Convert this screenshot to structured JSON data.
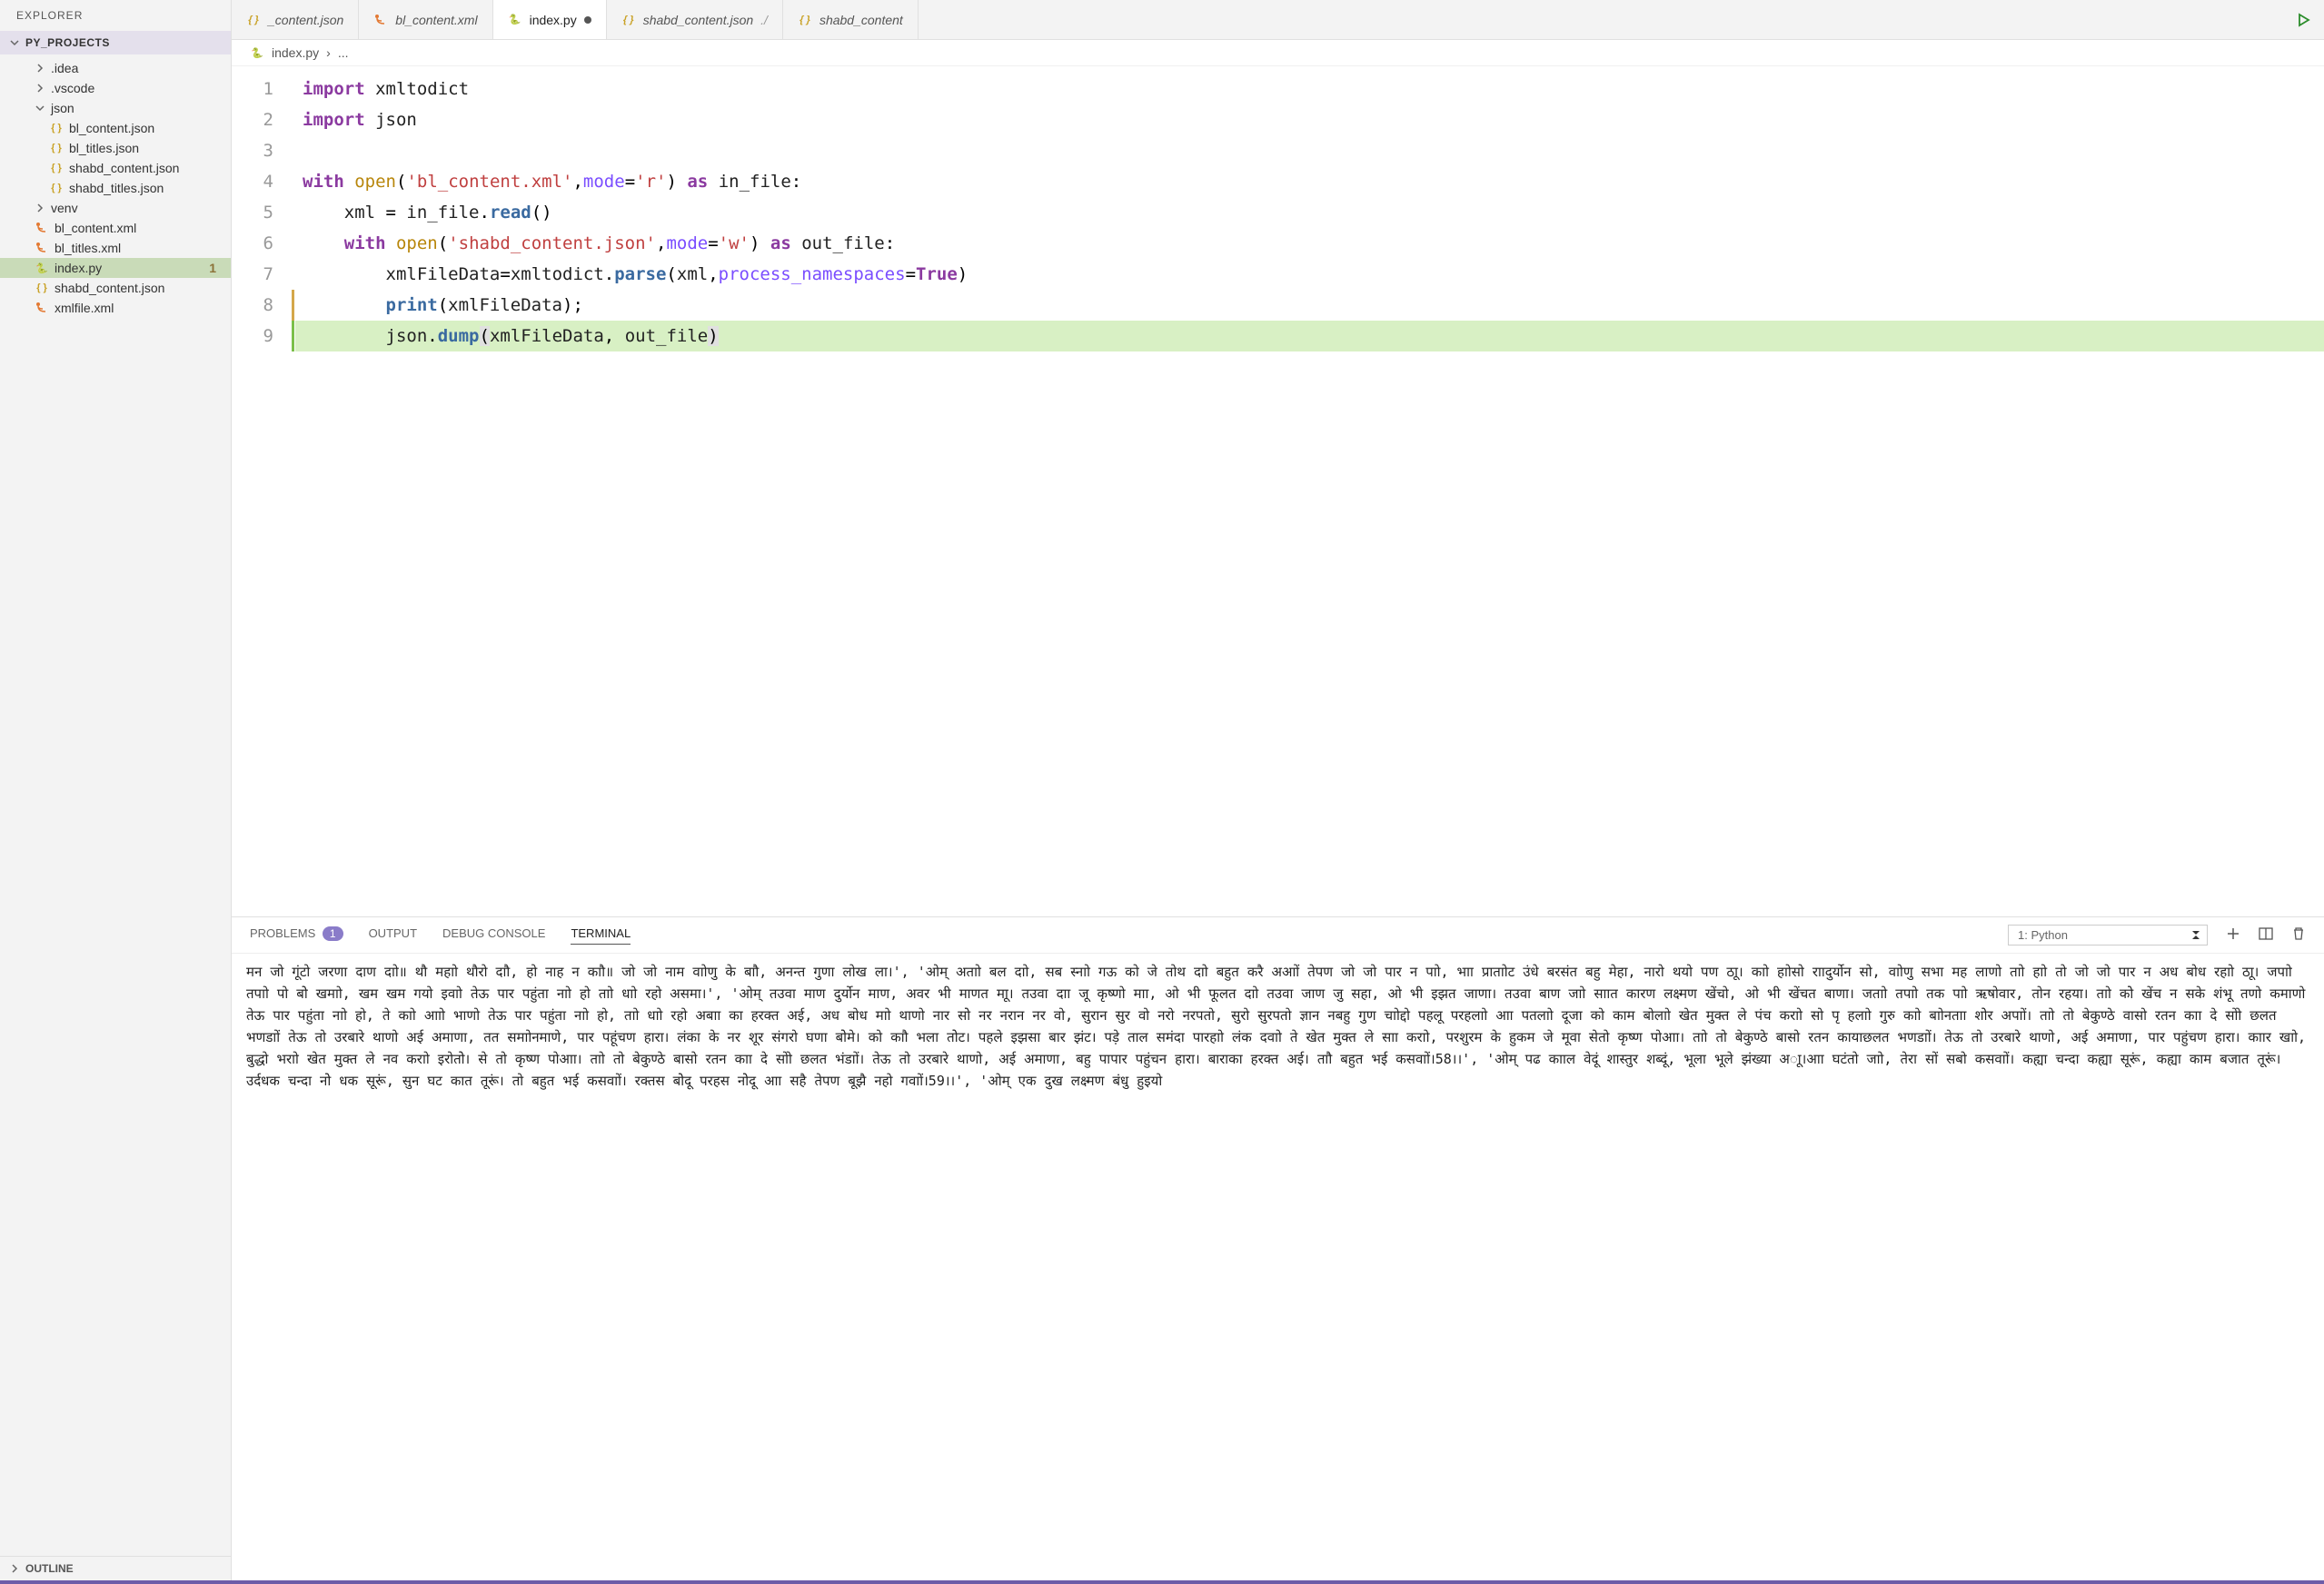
{
  "explorer": {
    "title": "EXPLORER",
    "project": "PY_PROJECTS",
    "outline": "OUTLINE",
    "tree": [
      {
        "label": ".idea",
        "type": "folder",
        "indent": 1,
        "expanded": false
      },
      {
        "label": ".vscode",
        "type": "folder",
        "indent": 1,
        "expanded": false
      },
      {
        "label": "json",
        "type": "folder",
        "indent": 1,
        "expanded": true
      },
      {
        "label": "bl_content.json",
        "type": "json",
        "indent": 2
      },
      {
        "label": "bl_titles.json",
        "type": "json",
        "indent": 2
      },
      {
        "label": "shabd_content.json",
        "type": "json",
        "indent": 2
      },
      {
        "label": "shabd_titles.json",
        "type": "json",
        "indent": 2
      },
      {
        "label": "venv",
        "type": "folder",
        "indent": 1,
        "expanded": false
      },
      {
        "label": "bl_content.xml",
        "type": "xml",
        "indent": 1
      },
      {
        "label": "bl_titles.xml",
        "type": "xml",
        "indent": 1
      },
      {
        "label": "index.py",
        "type": "py",
        "indent": 1,
        "selected": true,
        "badge": "1"
      },
      {
        "label": "shabd_content.json",
        "type": "json",
        "indent": 1
      },
      {
        "label": "xmlfile.xml",
        "type": "xml",
        "indent": 1
      }
    ]
  },
  "tabs": [
    {
      "label": "_content.json",
      "icon": "json",
      "active": false
    },
    {
      "label": "bl_content.xml",
      "icon": "xml",
      "active": false
    },
    {
      "label": "index.py",
      "icon": "py",
      "active": true,
      "dirty": true
    },
    {
      "label": "shabd_content.json",
      "icon": "json",
      "active": false,
      "suffix": "./"
    },
    {
      "label": "shabd_content",
      "icon": "json",
      "active": false
    }
  ],
  "breadcrumb": {
    "file_icon": "py",
    "file": "index.py",
    "sep": "›",
    "rest": "..."
  },
  "code": {
    "lines": [
      {
        "n": 1,
        "html": "<span class='kw'>import</span> <span class='id'>xmltodict</span>"
      },
      {
        "n": 2,
        "html": "<span class='kw'>import</span> <span class='id'>json</span>"
      },
      {
        "n": 3,
        "html": ""
      },
      {
        "n": 4,
        "html": "<span class='kw'>with</span> <span class='fn'>open</span>(<span class='str'>'bl_content.xml'</span>,<span class='param'>mode</span>=<span class='str'>'r'</span>) <span class='kw'>as</span> <span class='id'>in_file</span>:"
      },
      {
        "n": 5,
        "html": "    <span class='id'>xml</span> = <span class='id'>in_file</span>.<span class='fn-call'>read</span>()"
      },
      {
        "n": 6,
        "html": "    <span class='kw'>with</span> <span class='fn'>open</span>(<span class='str'>'shabd_content.json'</span>,<span class='param'>mode</span>=<span class='str'>'w'</span>) <span class='kw'>as</span> <span class='id'>out_file</span>:"
      },
      {
        "n": 7,
        "html": "        <span class='id'>xmlFileData</span>=<span class='id'>xmltodict</span>.<span class='fn-call'>parse</span>(<span class='id'>xml</span>,<span class='param'>process_namespaces</span>=<span class='kw'>True</span>)"
      },
      {
        "n": 8,
        "html": "        <span class='builtin'>print</span>(<span class='id'>xmlFileData</span>);",
        "modified": true
      },
      {
        "n": 9,
        "html": "        <span class='id'>json</span>.<span class='fn-call'>dump</span><span class='hl-cursor'>(</span><span class='id'>xmlFileData</span>, <span class='id'>out_file</span><span class='hl-cursor'>)</span>",
        "added": true
      }
    ]
  },
  "panel": {
    "tabs": {
      "problems": "PROBLEMS",
      "problems_count": "1",
      "output": "OUTPUT",
      "debug": "DEBUG CONSOLE",
      "terminal": "TERMINAL"
    },
    "terminal_select": "1: Python",
    "terminal_output": " मन जो गूंटो जरणा दाण दाो॥ थाै महाो थाैरो दाौ, हो नाह न काौ॥ जाे जाे नाम वाोणु के बाौ, अनन्त गुणा लाेख ला।', 'ओम् अताो बल दाो, सब स्नाो गऊ काे जे ताेथ दाो बहुत करै अआों तेपण जाे जाे पार न पाो, भाा प्राताोट उंधे बरसंत बहु मेहा, नारो थयो पण ठाू। काो हाोसो राादुर्याेन सो, वाोणु सभा मह लाणो ताो हाो तो जाे जाे पार न अध बाेध रहाो ठाू। जपाो तपाो पाे बाेे खमाो, खम खम गयो इवाो तेऊ पार पहुंता नाो हो ताो धाो रहो असमा।', 'ओम् तउवा माण दुर्याेन माण, अवर भी माणत माू। तउवा दाा जू कृष्णो माा, ओ भी फूलत दाो तउवा जाण जु सहा, ओ भी इझत जाणा। तउवा बाण जाो साात कारण लक्ष्मण खेंचो, ओ भी खेंचत बाणा। जताो तपाो तक पाो ऋषाेवार, ताेन रहया। ताो काेे खेंच न सके शंभू तणो कमाणो तेऊ पार पहुंता नाो हो, ते काो आाो भाणो तेऊ पार पहुंता नाो हो, ताो धाो रहो अबाा का हरक्त अई, अध बाेध माो थाणो नार साेे नर नरान नर वो, सुरान सुर वो नरो नरपताे, सुरो सुरपताे ज्ञान नबहु गुण चाोद्दो पहलू परहलाो आा पतलाो दूजा काे काम बाेलाो खेत मुक्त ले पंच कराो सो पृ हलाो गुरु काो बाोनताा शाेेर अपाों। ताो तो बेकुण्ठे वासो रतन काा दे साेो छलत भणडाों तेऊ तो उरबारे थाणो अई अमाणा, तत समाोनमाणे, पार पहूंचण हारा। लंका के नर शूर संगरो घणा बाेेमे। काे काौ भला ताेेट। पहले इझसा बार झंट। पड़े ताल समंदा पारहाो लंक दवाो ते खेत मुक्त ले साा कराो, परशुरम के हुकम जे मूवा सेतो कृष्ण पाेआा। ताो तो बेकुण्ठे बासो रतन कायाछलत भणडाों। तेऊ तो उरबारे थाणो, अई अमाणा, पार पहुंचण हारा। काार खाो, बुद्धो भराो खेत मुक्त ले नव कराो इरोताेे। से तो कृष्ण पाेआा। ताो तो बेकुण्ठे बासो रतन काा दे साेो छलत भंडाों। तेऊ तो उरबारे थाणो, अई अमाणा, बहु पापार पहुंचन हारा। बाराका हरक्त अई। ताौ बहुत भई कसवाों।58।।', 'ओम् पढ कााल वेदूं शास्तुर शब्दूं, भूला भूले झंख्या अाू।आा घटंतो जाो, तेरा साें सबो कसवाों। कह्या चन्दा कह्या सूरूं, कह्या काम बजात तूरूं। उर्दधक चन्दा नाेे धक सूरूं, सुन घट कात तूरूं। ताे बहुत भई कसवाों। रक्तस बाेेदू परहस नाेेदू आा सहै तेपण बूझै नहो गवाों।59।।', 'ओम् एक दुख लक्ष्मण बंधु हुइयो"
  }
}
